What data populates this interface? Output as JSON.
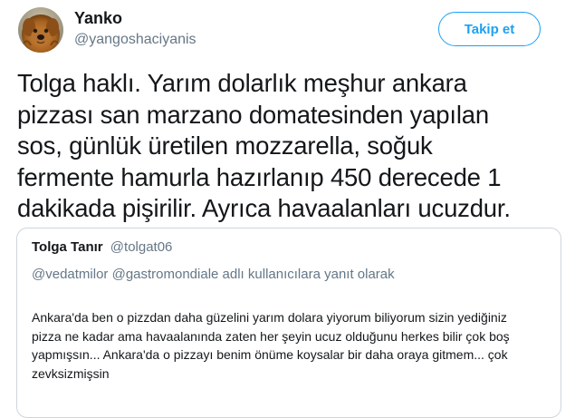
{
  "author": {
    "name": "Yanko",
    "handle": "@yangoshaciyanis",
    "avatar_icon": "dog-avatar-icon"
  },
  "follow_button": {
    "label": "Takip et",
    "color": "#1da1f2"
  },
  "tweet": {
    "lines": [
      "Tolga haklı. Yarım dolarlık meşhur ankara",
      "pizzası san marzano domatesinden yapılan",
      "sos, günlük üretilen mozzarella, soğuk",
      "fermente hamurla hazırlanıp 450 derecede 1",
      "dakikada pişirilir. Ayrıca havaalanları ucuzdur."
    ]
  },
  "quoted_tweet": {
    "name": "Tolga Tanır",
    "handle": "@tolgat06",
    "reply_context": "@vedatmilor @gastromondiale adlı kullanıcılara yanıt olarak",
    "lines": [
      "Ankara'da ben o pizzdan daha güzelini yarım dolara yiyorum biliyorum sizin yediğiniz",
      "pizza ne kadar ama havaalanında zaten her şeyin ucuz olduğunu herkes bilir çok boş",
      "yapmışsın... Ankara'da o pizzayı benim önüme koysalar bir daha oraya gitmem... çok",
      "zevksizmişsin"
    ]
  }
}
